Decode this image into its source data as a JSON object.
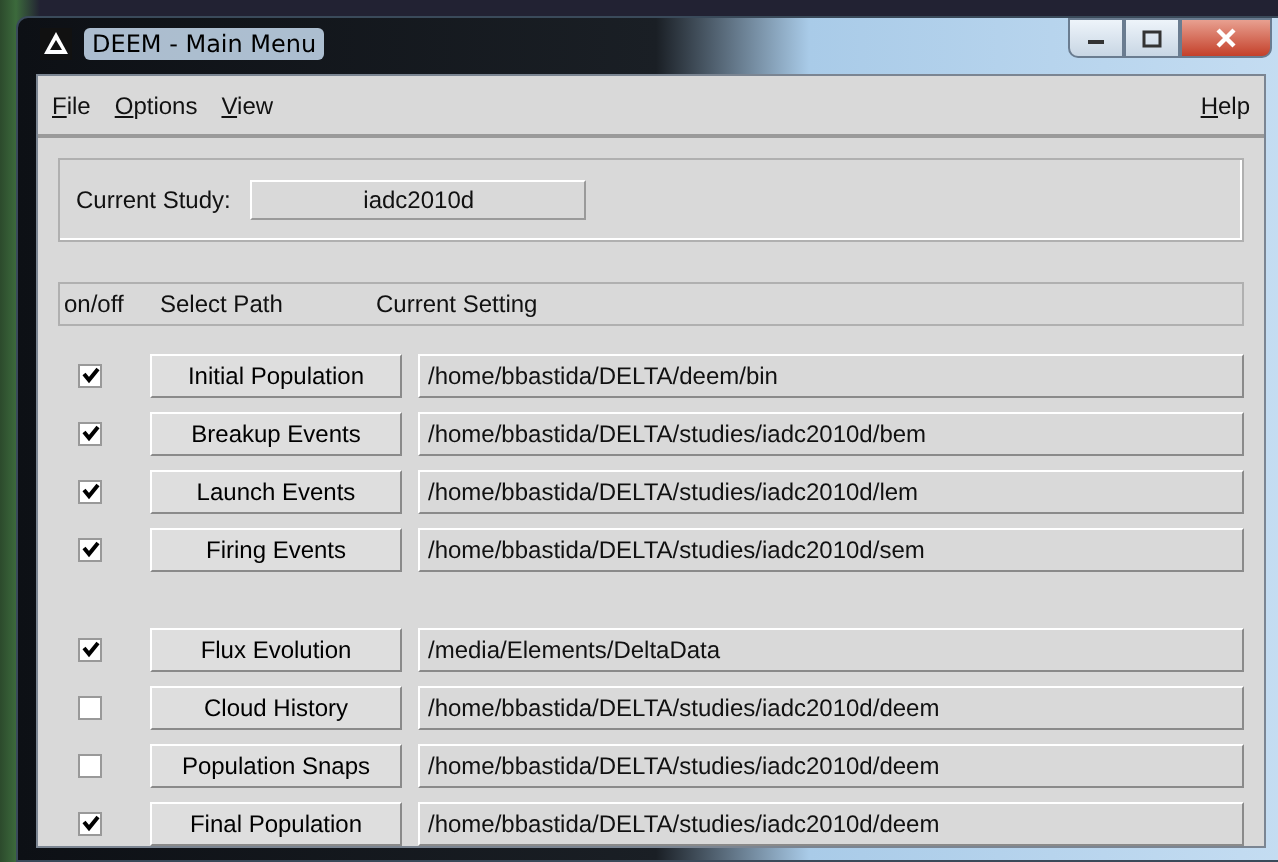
{
  "window": {
    "title": "DEEM - Main Menu"
  },
  "menu": [
    "File",
    "Options",
    "View"
  ],
  "menu_right": [
    "Help"
  ],
  "study": {
    "label": "Current Study:",
    "value": "iadc2010d"
  },
  "columns": [
    "on/off",
    "Select Path",
    "Current Setting"
  ],
  "groups": [
    [
      {
        "checked": true,
        "button": "Initial Population",
        "setting": "/home/bbastida/DELTA/deem/bin"
      },
      {
        "checked": true,
        "button": "Breakup Events",
        "setting": "/home/bbastida/DELTA/studies/iadc2010d/bem"
      },
      {
        "checked": true,
        "button": "Launch Events",
        "setting": "/home/bbastida/DELTA/studies/iadc2010d/lem"
      },
      {
        "checked": true,
        "button": "Firing Events",
        "setting": "/home/bbastida/DELTA/studies/iadc2010d/sem"
      }
    ],
    [
      {
        "checked": true,
        "button": "Flux Evolution",
        "setting": "/media/Elements/DeltaData"
      },
      {
        "checked": false,
        "button": "Cloud History",
        "setting": "/home/bbastida/DELTA/studies/iadc2010d/deem"
      },
      {
        "checked": false,
        "button": "Population Snaps",
        "setting": "/home/bbastida/DELTA/studies/iadc2010d/deem"
      },
      {
        "checked": true,
        "button": "Final Population",
        "setting": "/home/bbastida/DELTA/studies/iadc2010d/deem"
      }
    ]
  ]
}
